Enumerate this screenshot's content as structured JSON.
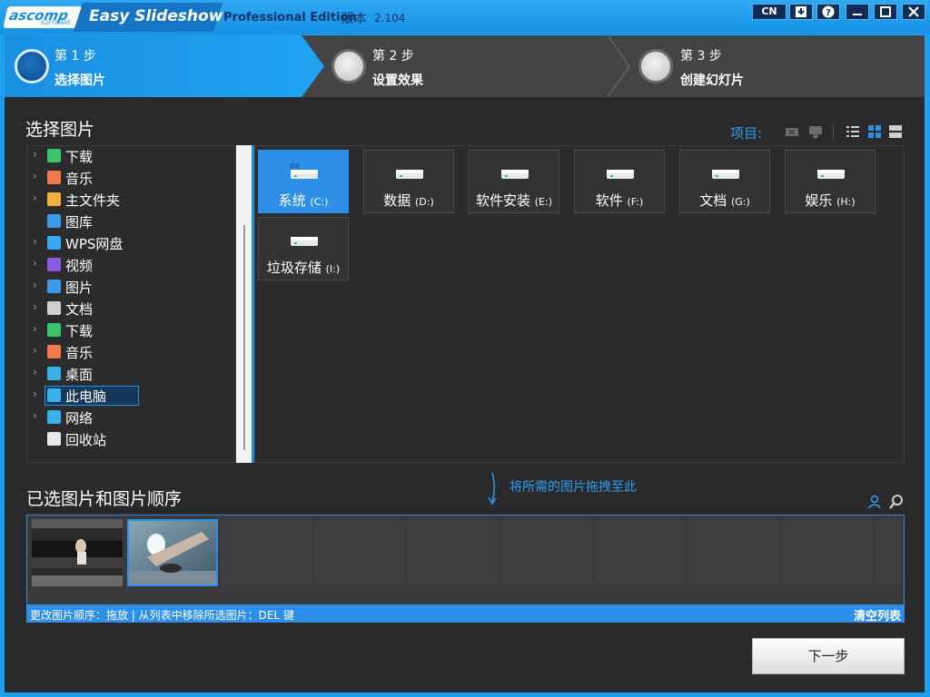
{
  "titlebar": {
    "logo_text": "ascomp",
    "logo_sub": "SOFTWARE",
    "app_name": "Easy Slideshow",
    "edition": "Professional Edition",
    "version_label": "版本",
    "version": "2.104",
    "lang_button": "CN"
  },
  "wizard": {
    "steps": [
      {
        "num": "第 1 步",
        "label": "选择图片"
      },
      {
        "num": "第 2 步",
        "label": "设置效果"
      },
      {
        "num": "第 3 步",
        "label": "创建幻灯片"
      }
    ]
  },
  "picker": {
    "title": "选择图片",
    "items_label": "项目:"
  },
  "tree": {
    "nodes": [
      {
        "label": "下载",
        "icon": "download-icon",
        "color": "#3cc46a",
        "expandable": true
      },
      {
        "label": "音乐",
        "icon": "music-icon",
        "color": "#f07a4a",
        "expandable": true
      },
      {
        "label": "主文件夹",
        "icon": "home-icon",
        "color": "#f0b040",
        "expandable": true
      },
      {
        "label": "图库",
        "icon": "gallery-icon",
        "color": "#3a9ae8",
        "expandable": false
      },
      {
        "label": "WPS网盘",
        "icon": "cloud-icon",
        "color": "#3aa8f0",
        "expandable": true
      },
      {
        "label": "视频",
        "icon": "video-icon",
        "color": "#8a5ae0",
        "expandable": true
      },
      {
        "label": "图片",
        "icon": "picture-icon",
        "color": "#3a9ae8",
        "expandable": true
      },
      {
        "label": "文档",
        "icon": "document-icon",
        "color": "#cfcfcf",
        "expandable": true
      },
      {
        "label": "下载",
        "icon": "download-icon",
        "color": "#3cc46a",
        "expandable": true
      },
      {
        "label": "音乐",
        "icon": "music-icon",
        "color": "#f07a4a",
        "expandable": true
      },
      {
        "label": "桌面",
        "icon": "desktop-icon",
        "color": "#3ab0e8",
        "expandable": true
      },
      {
        "label": "此电脑",
        "icon": "computer-icon",
        "color": "#3ab0e8",
        "expandable": true,
        "selected": true
      },
      {
        "label": "网络",
        "icon": "network-icon",
        "color": "#3ab0e8",
        "expandable": true
      },
      {
        "label": "回收站",
        "icon": "recycle-bin-icon",
        "color": "#e8e8e8",
        "expandable": false
      }
    ]
  },
  "drives": [
    {
      "name": "系统",
      "letter": "(C:)",
      "selected": true
    },
    {
      "name": "数据",
      "letter": "(D:)"
    },
    {
      "name": "软件安装",
      "letter": "(E:)"
    },
    {
      "name": "软件",
      "letter": "(F:)"
    },
    {
      "name": "文档",
      "letter": "(G:)"
    },
    {
      "name": "娱乐",
      "letter": "(H:)"
    },
    {
      "name": "垃圾存储",
      "letter": "(I:)"
    }
  ],
  "selected": {
    "title": "已选图片和图片顺序",
    "drop_hint": "将所需的图片拖拽至此",
    "status_left": "更改图片顺序：拖放 | 从列表中移除所选图片：DEL 键",
    "clear_list": "清空列表"
  },
  "next_button": "下一步"
}
